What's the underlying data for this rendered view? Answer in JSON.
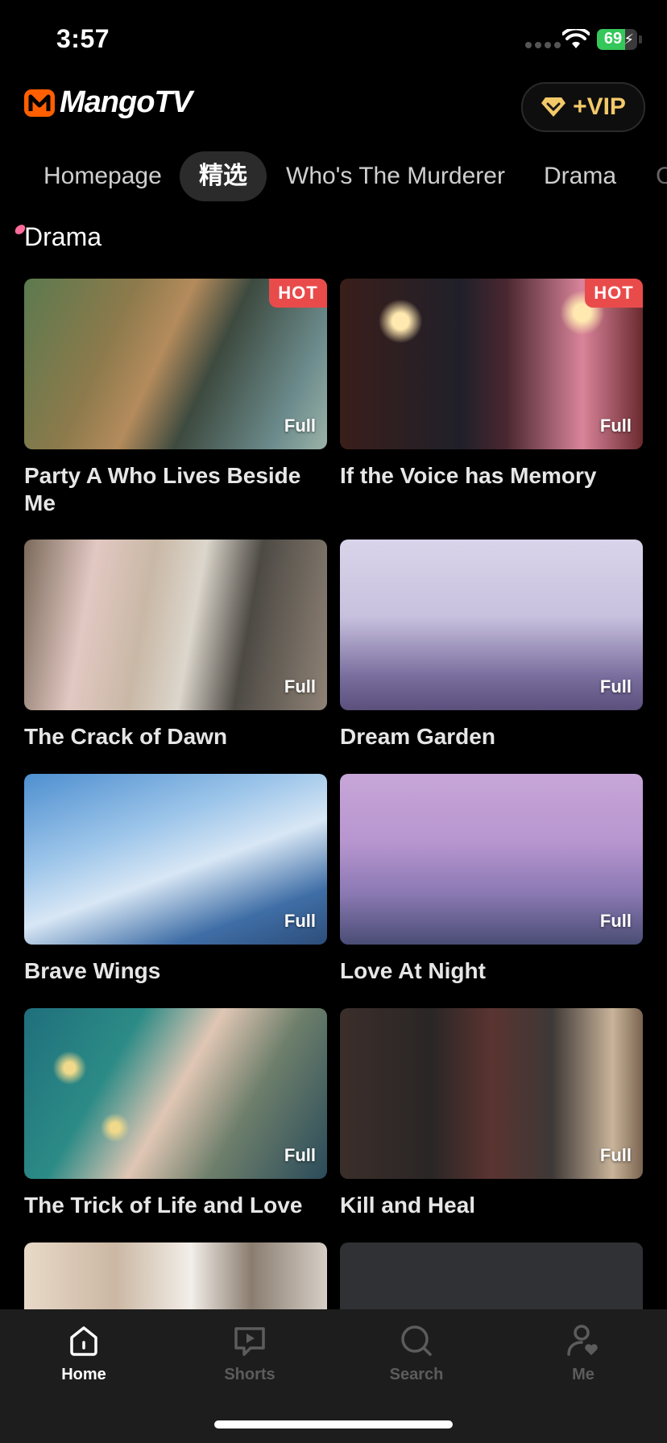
{
  "status": {
    "time": "3:57",
    "battery": "69",
    "battery_level": 0.69
  },
  "header": {
    "brand": "MangoTV",
    "vip_label": "+VIP",
    "vip_color": "#f3c969",
    "brand_color": "#ff5f00"
  },
  "tabs": [
    {
      "label": "Homepage"
    },
    {
      "label": "精选"
    },
    {
      "label": "Who's The Murderer"
    },
    {
      "label": "Drama"
    }
  ],
  "section": {
    "title": "Drama"
  },
  "badges": {
    "hot": "HOT",
    "full": "Full"
  },
  "cards": [
    {
      "title": "Party A Who Lives Beside Me"
    },
    {
      "title": "If the Voice has Memory"
    },
    {
      "title": "The Crack of Dawn"
    },
    {
      "title": "Dream Garden"
    },
    {
      "title": "Brave Wings"
    },
    {
      "title": "Love At Night"
    },
    {
      "title": "The Trick of Life and Love"
    },
    {
      "title": "Kill and Heal"
    }
  ],
  "nav": [
    {
      "label": "Home",
      "icon": "home-icon"
    },
    {
      "label": "Shorts",
      "icon": "shorts-play-icon"
    },
    {
      "label": "Search",
      "icon": "search-icon"
    },
    {
      "label": "Me",
      "icon": "profile-heart-icon"
    }
  ]
}
